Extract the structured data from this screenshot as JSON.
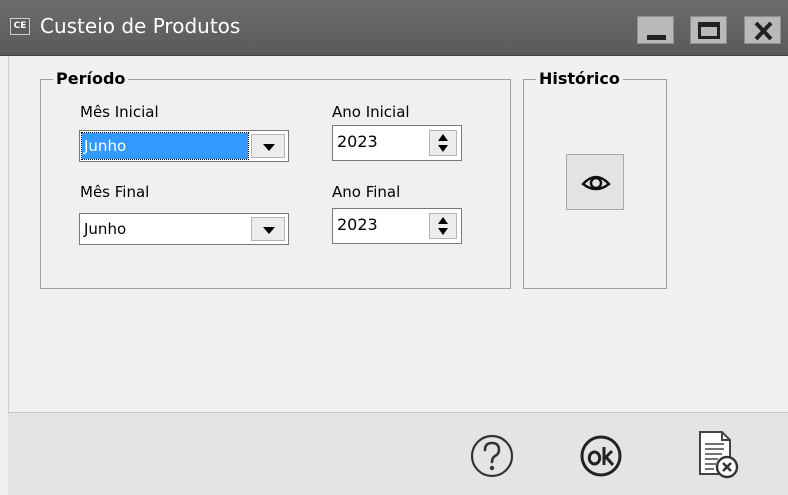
{
  "window": {
    "icon_text": "CE",
    "title": "Custeio de Produtos",
    "controls": [
      "minimize-icon",
      "maximize-icon",
      "close-icon"
    ]
  },
  "periodo": {
    "legend": "Período",
    "mes_inicial": {
      "label": "Mês Inicial",
      "value": "Junho"
    },
    "mes_final": {
      "label": "Mês Final",
      "value": "Junho"
    },
    "ano_inicial": {
      "label": "Ano Inicial",
      "value": "2023"
    },
    "ano_final": {
      "label": "Ano Final",
      "value": "2023"
    }
  },
  "historico": {
    "legend": "Histórico",
    "button_icon": "eye-icon"
  },
  "footer": {
    "buttons": [
      "help-icon",
      "ok-icon",
      "cancel-document-icon"
    ]
  },
  "colors": {
    "titlebar": "#5f5f5f",
    "selection": "#3399ff",
    "body": "#f0f0f0",
    "footer": "#e4e4e4"
  }
}
